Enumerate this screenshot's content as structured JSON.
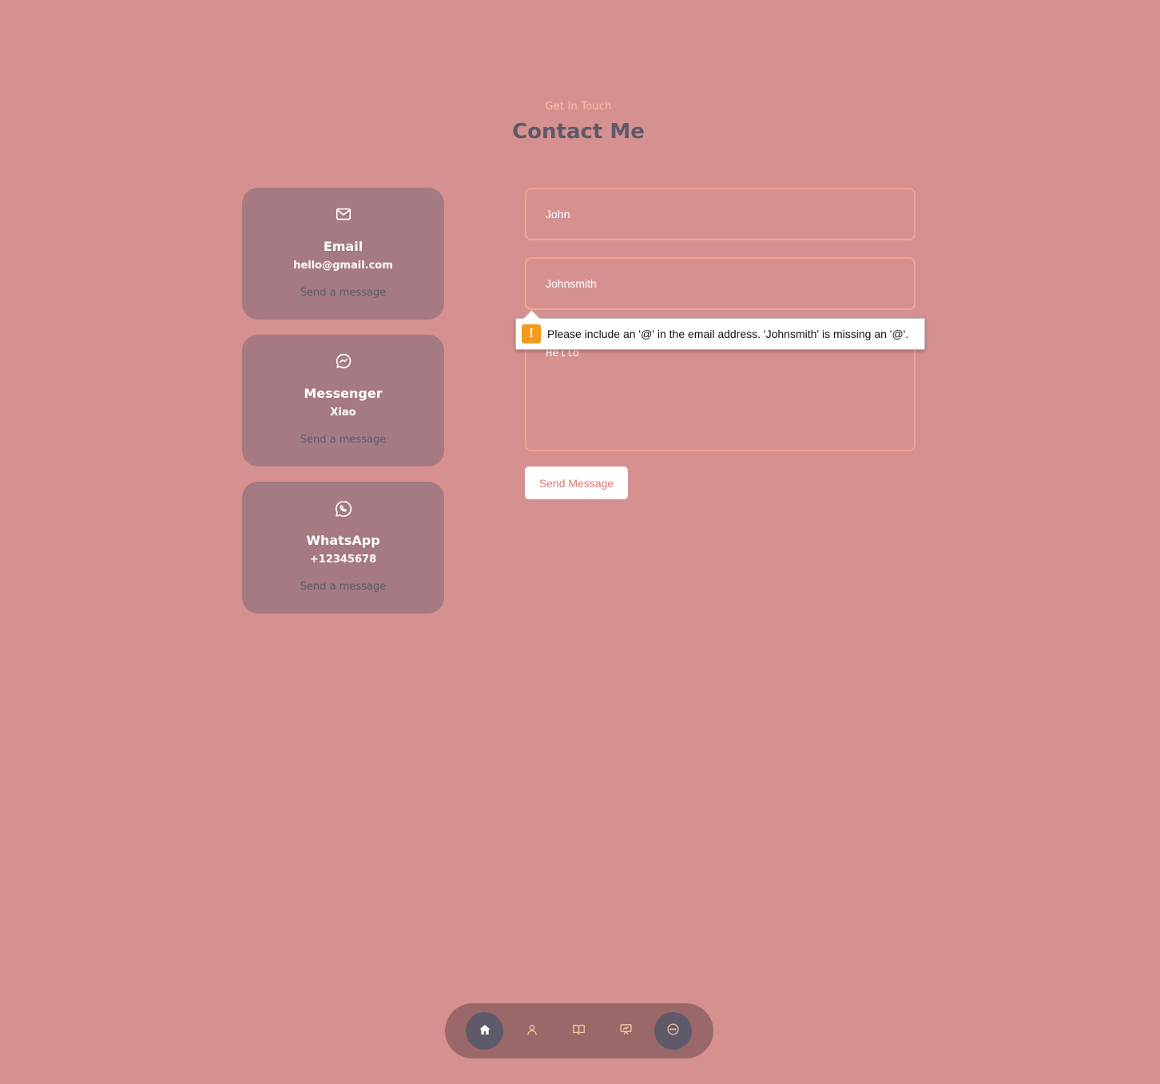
{
  "header": {
    "subtitle": "Get In Touch",
    "title": "Contact Me"
  },
  "contact_cards": [
    {
      "icon": "mail-icon",
      "label": "Email",
      "value": "hello@gmail.com",
      "action": "Send a message"
    },
    {
      "icon": "messenger-icon",
      "label": "Messenger",
      "value": "Xiao",
      "action": "Send a message"
    },
    {
      "icon": "whatsapp-icon",
      "label": "WhatsApp",
      "value": "+12345678",
      "action": "Send a message"
    }
  ],
  "form": {
    "name_value": "John",
    "email_value": "Johnsmith",
    "message_value": "Hello",
    "send_label": "Send Message"
  },
  "validation": {
    "message": "Please include an '@' in the email address. 'Johnsmith' is missing an '@'.",
    "icon": "warning-icon",
    "icon_glyph": "!"
  },
  "nav": {
    "items": [
      "home-icon",
      "user-icon",
      "book-icon",
      "presentation-icon",
      "chat-icon"
    ],
    "active": "chat-icon"
  },
  "colors": {
    "background": "#d69090",
    "card": "#a57a82",
    "accent": "#f2a58f",
    "dark": "#5e5a6a",
    "warning": "#f29c1f"
  }
}
